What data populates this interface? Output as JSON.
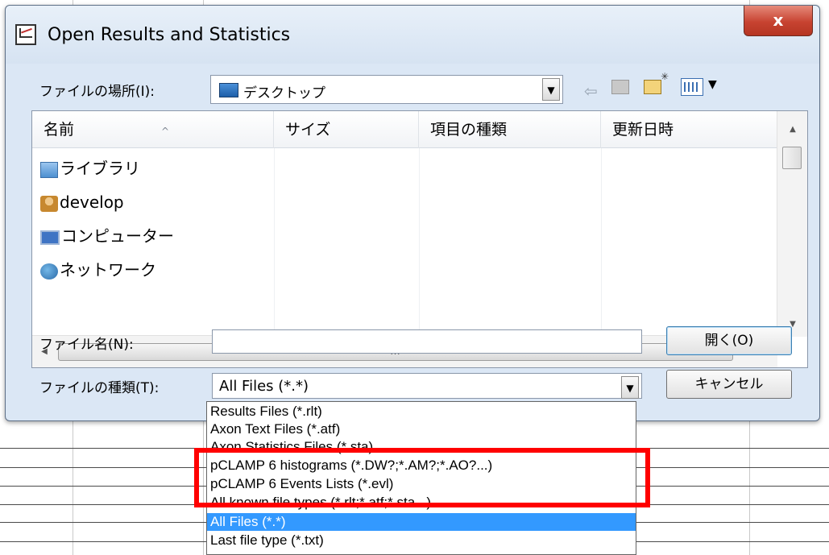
{
  "dialog": {
    "title": "Open Results and Statistics",
    "close_label": "x"
  },
  "location": {
    "label": "ファイルの場所(I):",
    "value": "デスクトップ"
  },
  "file_list": {
    "columns": [
      "名前",
      "サイズ",
      "項目の種類",
      "更新日時"
    ],
    "items": [
      {
        "name": "ライブラリ",
        "icon": "library-icon"
      },
      {
        "name": "develop",
        "icon": "user-folder-icon"
      },
      {
        "name": "コンピューター",
        "icon": "computer-icon"
      },
      {
        "name": "ネットワーク",
        "icon": "network-icon"
      }
    ],
    "hscroll_grip": "III"
  },
  "filename": {
    "label": "ファイル名(N):",
    "value": ""
  },
  "filetype": {
    "label": "ファイルの種類(T):",
    "value": "All Files (*.*)",
    "options": [
      "Results Files (*.rlt)",
      "Axon Text Files (*.atf)",
      "Axon Statistics Files (*.sta)",
      "pCLAMP 6 histograms (*.DW?;*.AM?;*.AO?...)",
      "pCLAMP 6 Events Lists (*.evl)",
      "All known file types (*.rlt;*.atf;*.sta...)",
      "All Files (*.*)",
      "Last file type (*.txt)"
    ],
    "selected_index": 6
  },
  "buttons": {
    "open": "開く(O)",
    "cancel": "キャンセル"
  },
  "colors": {
    "selection": "#3399ff",
    "highlight": "#ff0000",
    "close": "#c74331"
  }
}
